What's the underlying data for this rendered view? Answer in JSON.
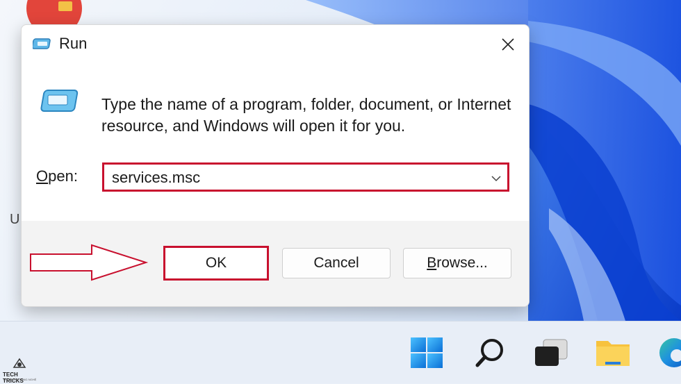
{
  "dialog": {
    "title": "Run",
    "description": "Type the name of a program, folder, document, or Internet resource, and Windows will open it for you.",
    "open_label_first": "O",
    "open_label_rest": "pen:",
    "open_value": "services.msc",
    "buttons": {
      "ok": "OK",
      "cancel": "Cancel",
      "browse_first": "B",
      "browse_rest": "rowse..."
    }
  },
  "desktop": {
    "partial_label": "U"
  },
  "taskbar": {
    "icons": [
      "windows-start-icon",
      "search-icon",
      "task-view-icon",
      "file-explorer-icon",
      "edge-browser-icon"
    ]
  },
  "watermark": {
    "title": "TECH TRICKS",
    "subtitle": "THỦ THUẬT CÔNG NGHỆ"
  },
  "colors": {
    "highlight": "#c8102e",
    "taskbar": "#e8eef7",
    "wallpaper_accent": "#1c5fe0"
  }
}
